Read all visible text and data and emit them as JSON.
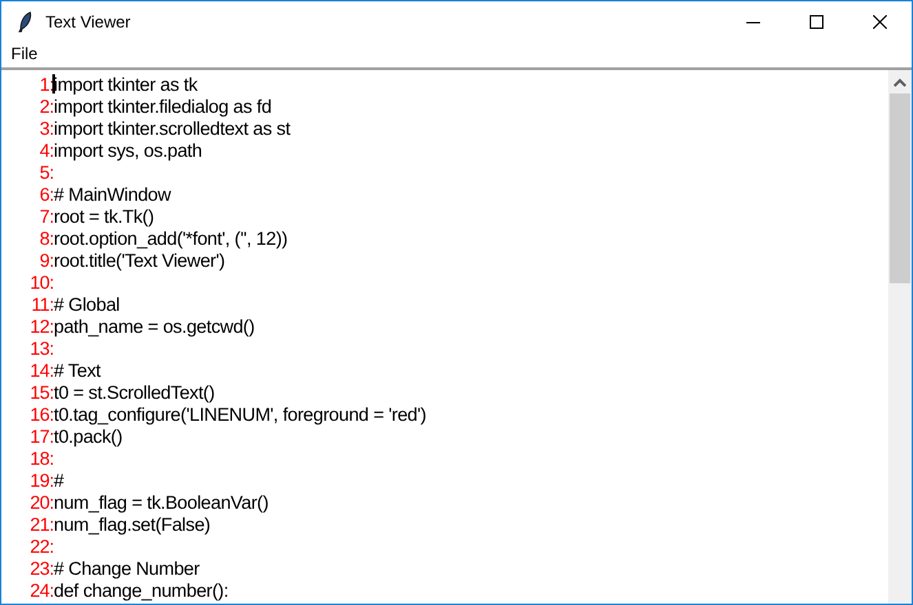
{
  "window": {
    "title": "Text Viewer"
  },
  "menu": [
    {
      "label": "File"
    }
  ],
  "lines": [
    {
      "number": "1:",
      "text": "import tkinter as tk"
    },
    {
      "number": "2:",
      "text": "import tkinter.filedialog as fd"
    },
    {
      "number": "3:",
      "text": "import tkinter.scrolledtext as st"
    },
    {
      "number": "4:",
      "text": "import sys, os.path"
    },
    {
      "number": "5:"
    },
    {
      "number": "6:",
      "text": "# MainWindow"
    },
    {
      "number": "7:",
      "text": "root = tk.Tk()"
    },
    {
      "number": "8:",
      "text": "root.option_add('*font', ('', 12))"
    },
    {
      "number": "9:",
      "text": "root.title('Text Viewer')"
    },
    {
      "number": "10:"
    },
    {
      "number": "11:",
      "text": "# Global"
    },
    {
      "number": "12:",
      "text": "path_name = os.getcwd()"
    },
    {
      "number": "13:"
    },
    {
      "number": "14:",
      "text": "# Text"
    },
    {
      "number": "15:",
      "text": "t0 = st.ScrolledText()"
    },
    {
      "number": "16:",
      "text": "t0.tag_configure('LINENUM', foreground = 'red')"
    },
    {
      "number": "17:",
      "text": "t0.pack()"
    },
    {
      "number": "18:"
    },
    {
      "number": "19:",
      "text": "#"
    },
    {
      "number": "20:",
      "text": "num_flag = tk.BooleanVar()"
    },
    {
      "number": "21:",
      "text": "num_flag.set(False)"
    },
    {
      "number": "22:"
    },
    {
      "number": "23:",
      "text": "# Change Number"
    },
    {
      "number": "24:",
      "text": "def change_number():"
    }
  ]
}
